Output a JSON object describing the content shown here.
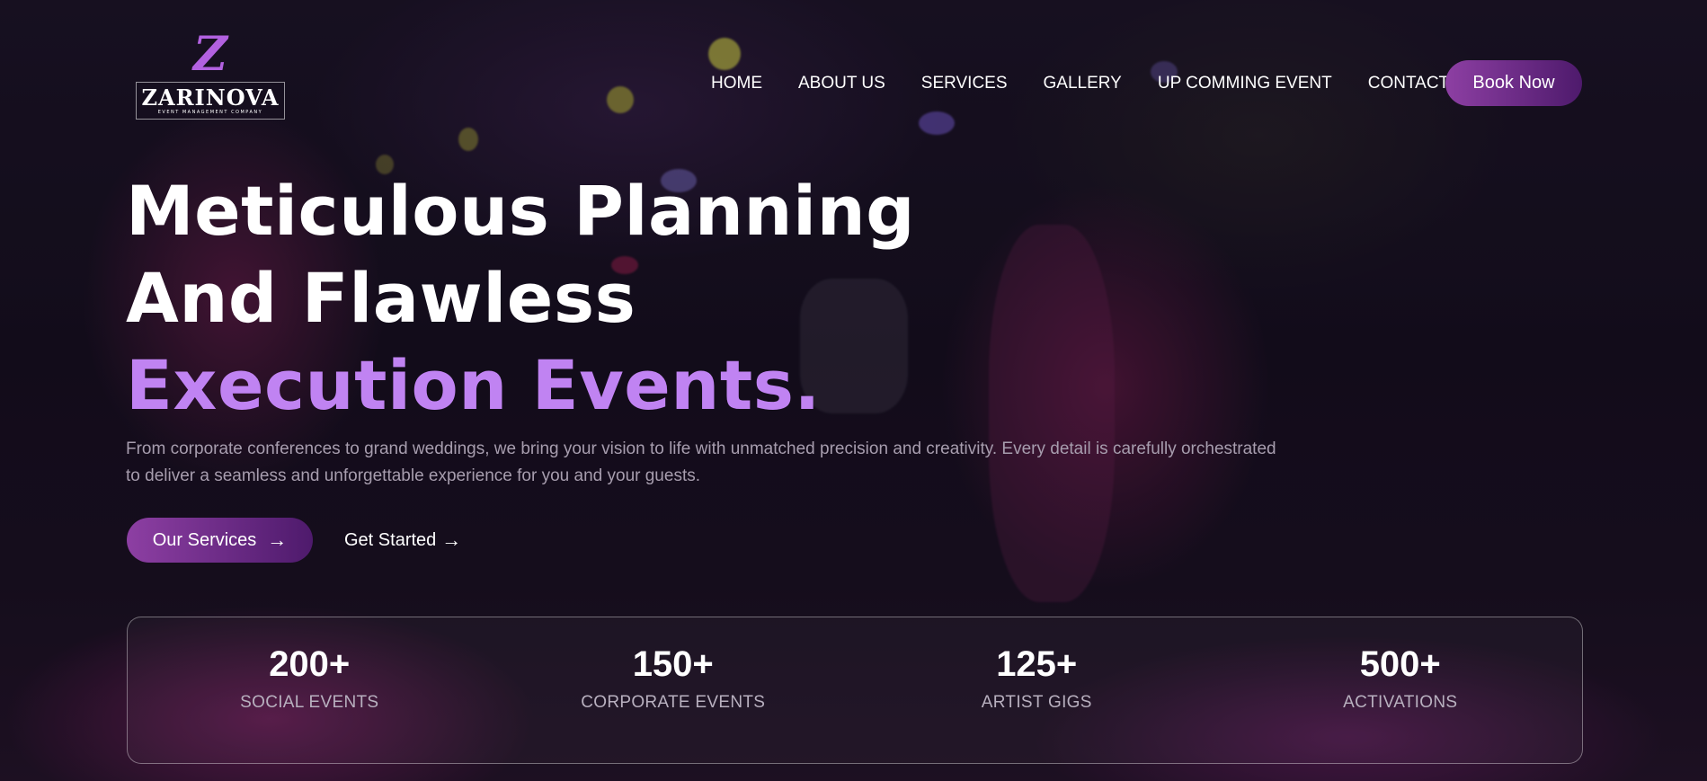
{
  "brand": {
    "logo_letter": "Z",
    "name": "ZARINOVA",
    "tagline": "EVENT MANAGEMENT COMPANY",
    "accent_color": "#c083f2",
    "button_gradient": [
      "#8d3fa3",
      "#4e1a6c"
    ]
  },
  "nav": {
    "items": [
      {
        "label": "HOME"
      },
      {
        "label": "ABOUT US"
      },
      {
        "label": "SERVICES"
      },
      {
        "label": "GALLERY"
      },
      {
        "label": "UP COMMING EVENT"
      },
      {
        "label": "CONTACT"
      }
    ],
    "cta_label": "Book Now"
  },
  "hero": {
    "title_line1": "Meticulous Planning",
    "title_line2": "And Flawless",
    "title_line3": "Execution Events.",
    "description": "From corporate conferences to grand weddings, we bring your vision to life with unmatched precision and creativity. Every detail is carefully orchestrated to deliver a seamless and unforgettable experience for you and your guests.",
    "primary_button": "Our Services",
    "primary_icon": "arrow-right-icon",
    "secondary_button": "Get Started",
    "secondary_icon": "arrow-right-icon"
  },
  "stats": [
    {
      "value": "200+",
      "label": "SOCIAL EVENTS"
    },
    {
      "value": "150+",
      "label": "CORPORATE EVENTS"
    },
    {
      "value": "125+",
      "label": "ARTIST GIGS"
    },
    {
      "value": "500+",
      "label": "ACTIVATIONS"
    }
  ]
}
